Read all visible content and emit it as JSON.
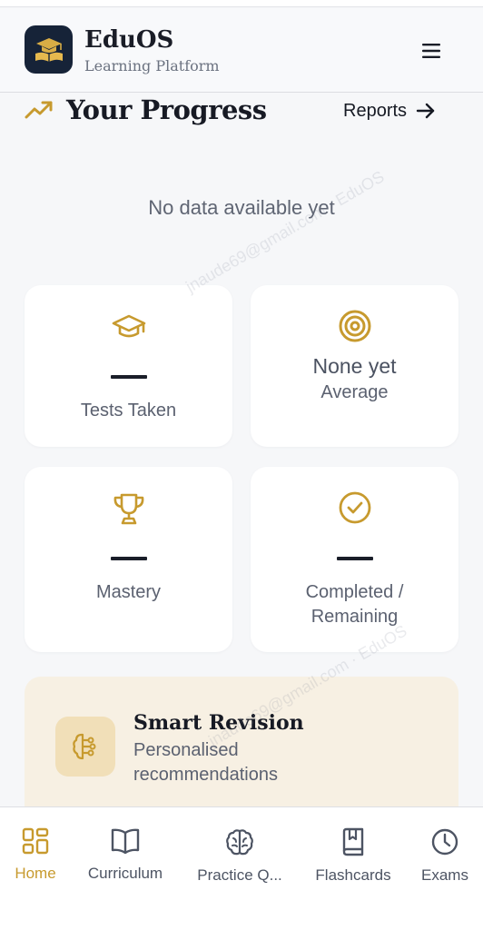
{
  "app": {
    "name": "EduOS",
    "subtitle": "Learning Platform",
    "logo_icon": "graduation-book-icon",
    "menu_icon": "hamburger-menu-icon"
  },
  "progress": {
    "title": "Your Progress",
    "title_icon": "trending-up-icon",
    "reports_label": "Reports",
    "reports_icon": "arrow-right-icon",
    "empty_text": "No data available yet"
  },
  "stats": [
    {
      "icon": "graduation-cap-icon",
      "value": "—",
      "label": "Tests Taken"
    },
    {
      "icon": "target-icon",
      "value": "None yet",
      "label": "Average"
    },
    {
      "icon": "trophy-icon",
      "value": "—",
      "label": "Mastery"
    },
    {
      "icon": "check-circle-icon",
      "value": "—",
      "label": "Completed / Remaining"
    }
  ],
  "smart_revision": {
    "icon": "brain-icon",
    "title": "Smart Revision",
    "subtitle": "Personalised recommendations"
  },
  "watermark": "jnaude69@gmail.com · EduOS",
  "nav": [
    {
      "label": "Home",
      "icon": "grid-icon",
      "active": true
    },
    {
      "label": "Curriculum",
      "icon": "open-book-icon",
      "active": false
    },
    {
      "label": "Practice Q...",
      "icon": "brain-icon",
      "active": false
    },
    {
      "label": "Flashcards",
      "icon": "bookmark-book-icon",
      "active": false
    },
    {
      "label": "Exams",
      "icon": "clock-icon",
      "active": false
    }
  ],
  "colors": {
    "accent": "#c79a2e",
    "logo_bg": "#162338",
    "text_dark": "#171a24",
    "text_muted": "#5b6170",
    "revision_bg": "#f7f0e3"
  }
}
